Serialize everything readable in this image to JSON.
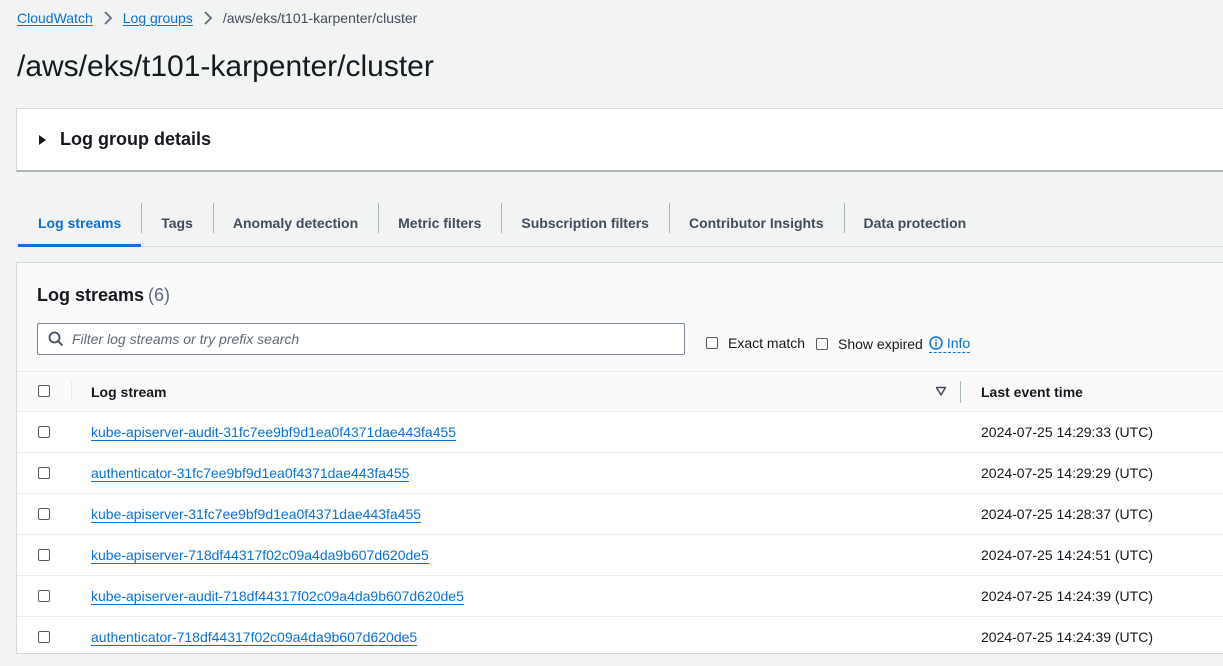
{
  "breadcrumb": {
    "items": [
      "CloudWatch",
      "Log groups"
    ],
    "current": "/aws/eks/t101-karpenter/cluster"
  },
  "page": {
    "title": "/aws/eks/t101-karpenter/cluster"
  },
  "details": {
    "title": "Log group details"
  },
  "tabs": [
    {
      "label": "Log streams",
      "active": true
    },
    {
      "label": "Tags"
    },
    {
      "label": "Anomaly detection"
    },
    {
      "label": "Metric filters"
    },
    {
      "label": "Subscription filters"
    },
    {
      "label": "Contributor Insights"
    },
    {
      "label": "Data protection"
    }
  ],
  "streams": {
    "title": "Log streams",
    "count": "(6)",
    "filter_placeholder": "Filter log streams or try prefix search",
    "exact_match_label": "Exact match",
    "show_expired_label": "Show expired",
    "info_label": "Info",
    "columns": {
      "stream": "Log stream",
      "time": "Last event time"
    },
    "rows": [
      {
        "name": "kube-apiserver-audit-31fc7ee9bf9d1ea0f4371dae443fa455",
        "time": "2024-07-25 14:29:33 (UTC)"
      },
      {
        "name": "authenticator-31fc7ee9bf9d1ea0f4371dae443fa455",
        "time": "2024-07-25 14:29:29 (UTC)"
      },
      {
        "name": "kube-apiserver-31fc7ee9bf9d1ea0f4371dae443fa455",
        "time": "2024-07-25 14:28:37 (UTC)"
      },
      {
        "name": "kube-apiserver-718df44317f02c09a4da9b607d620de5",
        "time": "2024-07-25 14:24:51 (UTC)"
      },
      {
        "name": "kube-apiserver-audit-718df44317f02c09a4da9b607d620de5",
        "time": "2024-07-25 14:24:39 (UTC)"
      },
      {
        "name": "authenticator-718df44317f02c09a4da9b607d620de5",
        "time": "2024-07-25 14:24:39 (UTC)"
      }
    ]
  },
  "colors": {
    "link": "#0972d3",
    "text": "#16191f",
    "background": "#f2f3f3"
  },
  "icons": {
    "breadcrumb_separator": "chevron-right-icon",
    "details_toggle": "caret-right-icon",
    "filter": "search-icon",
    "info": "info-icon",
    "sort": "sort-descending-icon"
  }
}
